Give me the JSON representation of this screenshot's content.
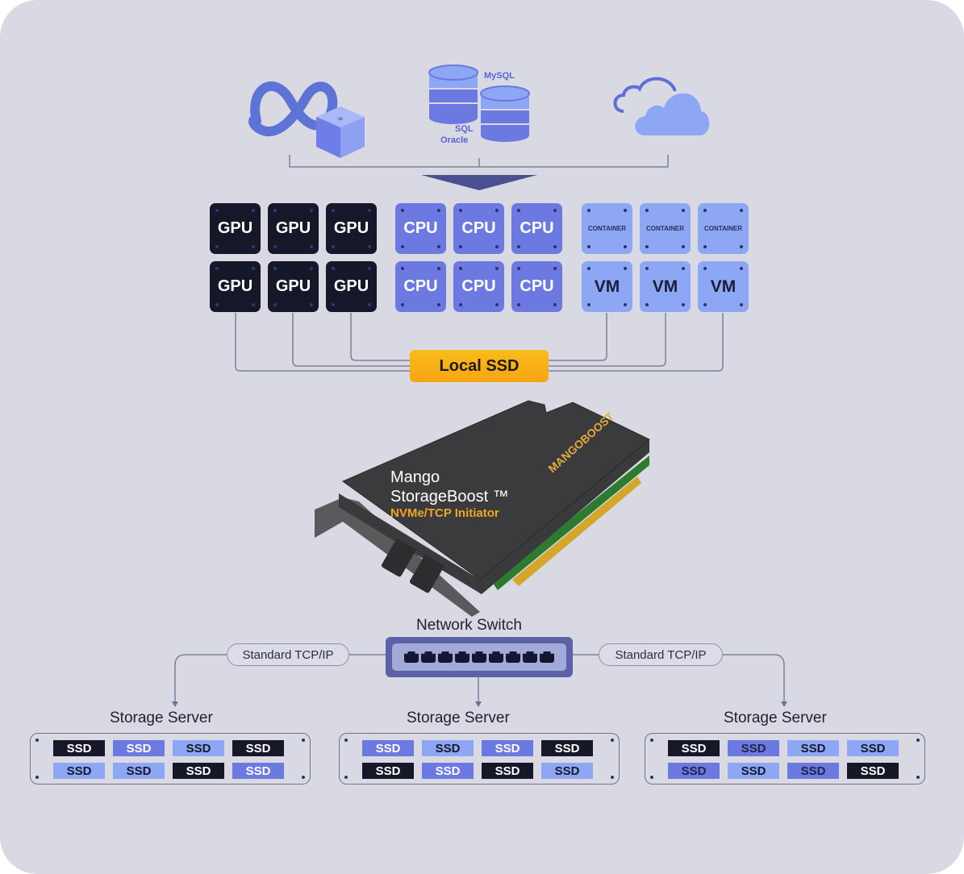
{
  "sources": {
    "meta_icon": "meta-infinity-logo",
    "database_labels": {
      "mysql": "MySQL",
      "sql": "SQL",
      "oracle": "Oracle"
    },
    "cloud_icon": "cloud-icon"
  },
  "compute": {
    "gpu_label": "GPU",
    "cpu_label": "CPU",
    "container_label": "CONTAINER",
    "vm_label": "VM",
    "grid": {
      "gpu": {
        "rows": 2,
        "cols": 3
      },
      "cpu": {
        "rows": 2,
        "cols": 3
      },
      "container_row": 3,
      "vm_row": 3
    }
  },
  "local_ssd": {
    "label": "Local SSD"
  },
  "card": {
    "title_line1": "Mango",
    "title_line2": "StorageBoost ™",
    "subtitle": "NVMe/TCP Initiator",
    "brand": "MANGOBOOST"
  },
  "network": {
    "switch_label": "Network Switch",
    "port_count": 9,
    "link_left": "Standard TCP/IP",
    "link_right": "Standard TCP/IP"
  },
  "servers": [
    {
      "title": "Storage Server",
      "ssd_label": "SSD",
      "rows": [
        [
          "dark",
          "medium",
          "light",
          "dark"
        ],
        [
          "light",
          "light",
          "dark",
          "medium"
        ]
      ]
    },
    {
      "title": "Storage Server",
      "ssd_label": "SSD",
      "rows": [
        [
          "medium",
          "light",
          "medium",
          "dark"
        ],
        [
          "dark",
          "medium",
          "dark",
          "light"
        ]
      ]
    },
    {
      "title": "Storage Server",
      "ssd_label": "SSD",
      "rows": [
        [
          "dark",
          "medium-alt",
          "light",
          "light"
        ],
        [
          "medium-alt",
          "light",
          "medium-alt",
          "dark"
        ]
      ]
    }
  ],
  "colors": {
    "background": "#d9d9e4",
    "gpu": "#161729",
    "cpu": "#6c79e0",
    "container_vm": "#8ea7f5",
    "local_ssd": "#f7a413",
    "accent_text": "#f0a623",
    "switch": "#5b62a8"
  }
}
